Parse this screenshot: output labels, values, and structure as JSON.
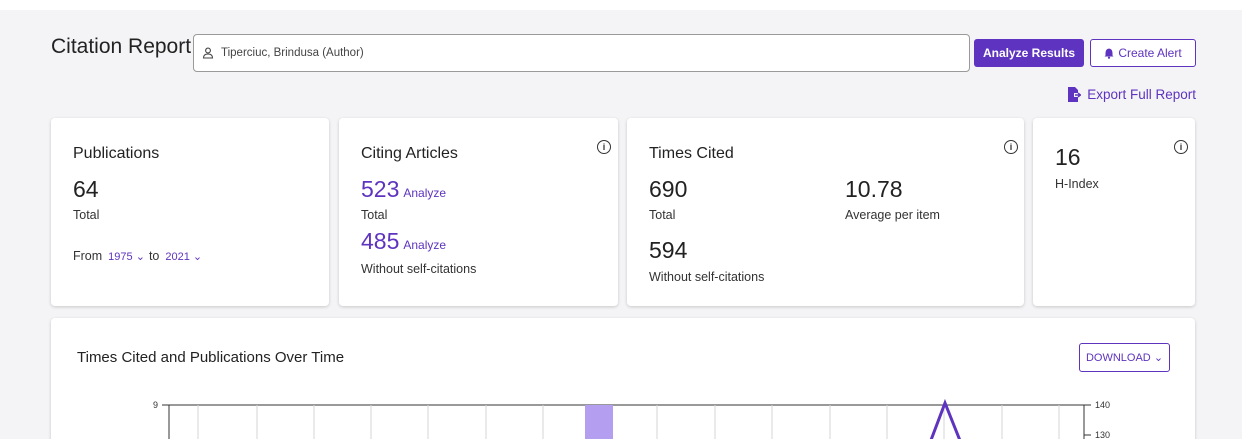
{
  "header": {
    "title": "Citation Report",
    "search_value": "Tiperciuc, Brindusa (Author)",
    "analyze_results": "Analyze Results",
    "create_alert": "Create Alert",
    "export": "Export Full Report"
  },
  "publications": {
    "title": "Publications",
    "value": "64",
    "value_label": "Total",
    "from_label": "From",
    "from_year": "1975",
    "to_label": "to",
    "to_year": "2021"
  },
  "citing": {
    "title": "Citing Articles",
    "total": "523",
    "total_link": "Analyze",
    "total_label": "Total",
    "without_self": "485",
    "without_link": "Analyze",
    "without_label": "Without self-citations"
  },
  "times_cited": {
    "title": "Times Cited",
    "total": "690",
    "total_label": "Total",
    "average": "10.78",
    "average_label": "Average per item",
    "without_self": "594",
    "without_label": "Without self-citations"
  },
  "h_index": {
    "value": "16",
    "label": "H-Index"
  },
  "chart": {
    "title": "Times Cited and Publications Over Time",
    "download": "DOWNLOAD",
    "left_tick": "9",
    "right_ticks": [
      "140",
      "130"
    ]
  },
  "colors": {
    "accent": "#5e33bf",
    "bar": "#b39ef0"
  }
}
